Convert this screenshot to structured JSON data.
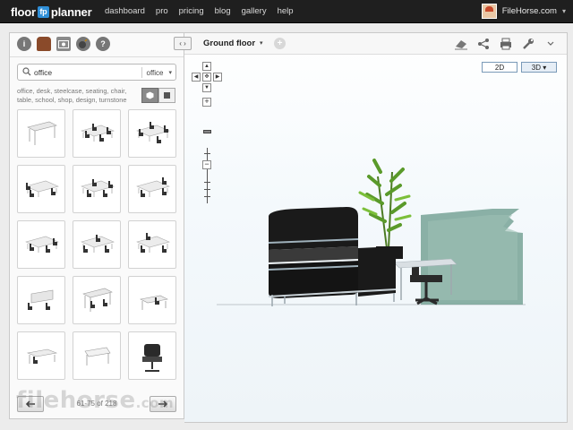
{
  "app": {
    "logo_left": "floor",
    "logo_mark": "fp",
    "logo_right": "planner"
  },
  "nav": {
    "items": [
      "dashboard",
      "pro",
      "pricing",
      "blog",
      "gallery",
      "help"
    ]
  },
  "user": {
    "name": "FileHorse.com",
    "caret": "▾"
  },
  "library": {
    "tool_icons": [
      "info-icon",
      "furniture-icon",
      "photo-icon",
      "bomb-icon",
      "help-icon"
    ],
    "search": {
      "value": "office",
      "placeholder": "Search",
      "category": "office",
      "caret": "▾"
    },
    "tags": "office, desk, steelcase, seating, chair, table, school, shop, design, turnstone",
    "pager": {
      "info": "61-75 of 218",
      "prev_icon": "arrow-left-icon",
      "next_icon": "arrow-right-icon"
    },
    "watermark": "filehorse",
    "watermark_suffix": ".com"
  },
  "canvas": {
    "collapse_label": "‹ ›",
    "floor_name": "Ground floor",
    "floor_caret": "▾",
    "add_floor": "+",
    "tool_icons": [
      "eraser-icon",
      "share-icon",
      "print-icon",
      "wrench-icon",
      "chevron-down-icon"
    ],
    "mode_2d": "2D",
    "mode_3d": "3D ▾",
    "zoom_in": "+",
    "zoom_out": "−"
  },
  "colors": {
    "topbar": "#1f1f1f",
    "accent": "#2f8fd8",
    "glass": "#6f9d90",
    "sofa": "#1a1a1a",
    "plant": "#5a9a2a"
  }
}
